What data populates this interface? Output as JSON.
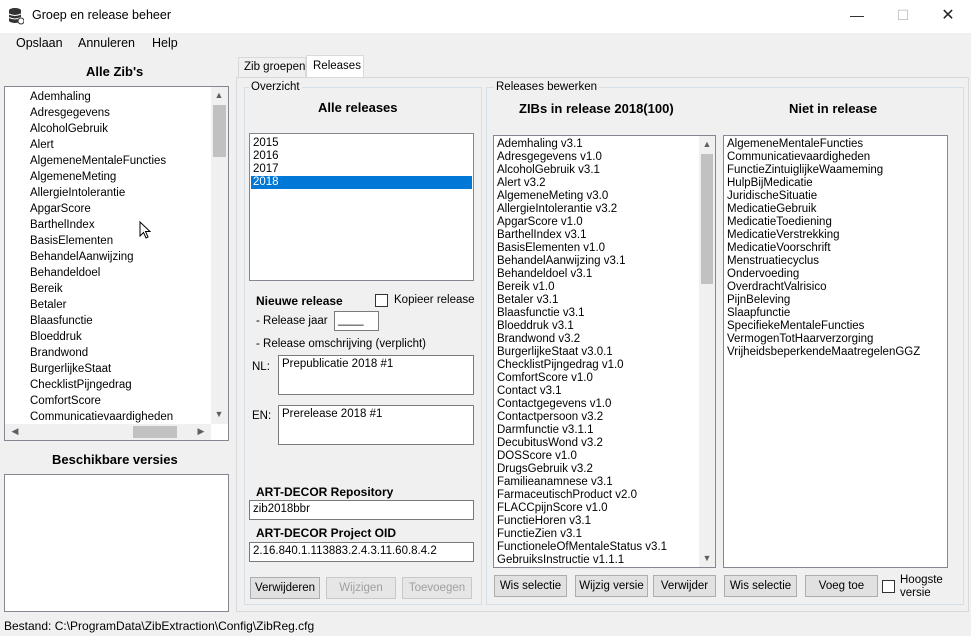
{
  "window": {
    "title": "Groep en release beheer"
  },
  "menu": {
    "items": [
      "Opslaan",
      "Annuleren",
      "Help"
    ]
  },
  "left": {
    "heading": "Alle Zib's",
    "zibs": [
      "Ademhaling",
      "Adresgegevens",
      "AlcoholGebruik",
      "Alert",
      "AlgemeneMentaleFuncties",
      "AlgemeneMeting",
      "AllergieIntolerantie",
      "ApgarScore",
      "BarthelIndex",
      "BasisElementen",
      "BehandelAanwijzing",
      "Behandeldoel",
      "Bereik",
      "Betaler",
      "Blaasfunctie",
      "Bloeddruk",
      "Brandwond",
      "BurgerlijkeStaat",
      "ChecklistPijngedrag",
      "ComfortScore",
      "Communicatievaardigheden"
    ],
    "versions_heading": "Beschikbare versies"
  },
  "tabs": {
    "groups": "Zib groepen",
    "releases": "Releases"
  },
  "overview": {
    "group_label": "Overzicht",
    "heading": "Alle releases",
    "releases": [
      "2015",
      "2016",
      "2017",
      "2018"
    ],
    "selected": "2018",
    "new_release": "Nieuwe release",
    "copy_release": "Kopieer release",
    "release_year_label": "- Release jaar",
    "release_year_value": "____",
    "description_label": "- Release omschrijving (verplicht)",
    "nl_label": "NL:",
    "nl_value": "Prepublicatie 2018 #1",
    "en_label": "EN:",
    "en_value": "Prerelease 2018 #1",
    "repo_heading": "ART-DECOR Repository",
    "repo_value": "zib2018bbr",
    "oid_heading": "ART-DECOR Project OID",
    "oid_value": "2.16.840.1.113883.2.4.3.11.60.8.4.2",
    "btn_delete": "Verwijderen",
    "btn_change": "Wijzigen",
    "btn_add": "Toevoegen"
  },
  "edit": {
    "group_label": "Releases bewerken",
    "in_heading": "ZIBs in release 2018(100)",
    "in_items": [
      "Ademhaling v3.1",
      "Adresgegevens v1.0",
      "AlcoholGebruik v3.1",
      "Alert v3.2",
      "AlgemeneMeting v3.0",
      "AllergieIntolerantie v3.2",
      "ApgarScore v1.0",
      "BarthelIndex v3.1",
      "BasisElementen v1.0",
      "BehandelAanwijzing v3.1",
      "Behandeldoel v3.1",
      "Bereik v1.0",
      "Betaler v3.1",
      "Blaasfunctie v3.1",
      "Bloeddruk v3.1",
      "Brandwond v3.2",
      "BurgerlijkeStaat v3.0.1",
      "ChecklistPijngedrag v1.0",
      "ComfortScore v1.0",
      "Contact v3.1",
      "Contactgegevens v1.0",
      "Contactpersoon v3.2",
      "Darmfunctie v3.1.1",
      "DecubitusWond v3.2",
      "DOSScore v1.0",
      "DrugsGebruik v3.2",
      "Familieanamnese v3.1",
      "FarmaceutischProduct v2.0",
      "FLACCpijnScore v1.0",
      "FunctieHoren v3.1",
      "FunctieZien v3.1",
      "FunctioneleOfMentaleStatus v3.1",
      "GebruiksInstructie v1.1.1"
    ],
    "out_heading": "Niet in release",
    "out_items": [
      "AlgemeneMentaleFuncties",
      "Communicatievaardigheden",
      "FunctieZintuiglijkeWaameming",
      "HulpBijMedicatie",
      "JuridischeSituatie",
      "MedicatieGebruik",
      "MedicatieToediening",
      "MedicatieVerstrekking",
      "MedicatieVoorschrift",
      "Menstruatiecyclus",
      "Ondervoeding",
      "OverdrachtValrisico",
      "PijnBeleving",
      "Slaapfunctie",
      "SpecifiekeMentaleFuncties",
      "VermogenTotHaarverzorging",
      "VrijheidsbeperkendeMaatregelenGGZ"
    ],
    "btn_clear_left": "Wis selectie",
    "btn_change_version": "Wijzig versie",
    "btn_remove": "Verwijder",
    "btn_clear_right": "Wis selectie",
    "btn_add": "Voeg toe",
    "highest_version": "Hoogste versie"
  },
  "status": {
    "text": "Bestand: C:\\ProgramData\\ZibExtraction\\Config\\ZibReg.cfg"
  }
}
